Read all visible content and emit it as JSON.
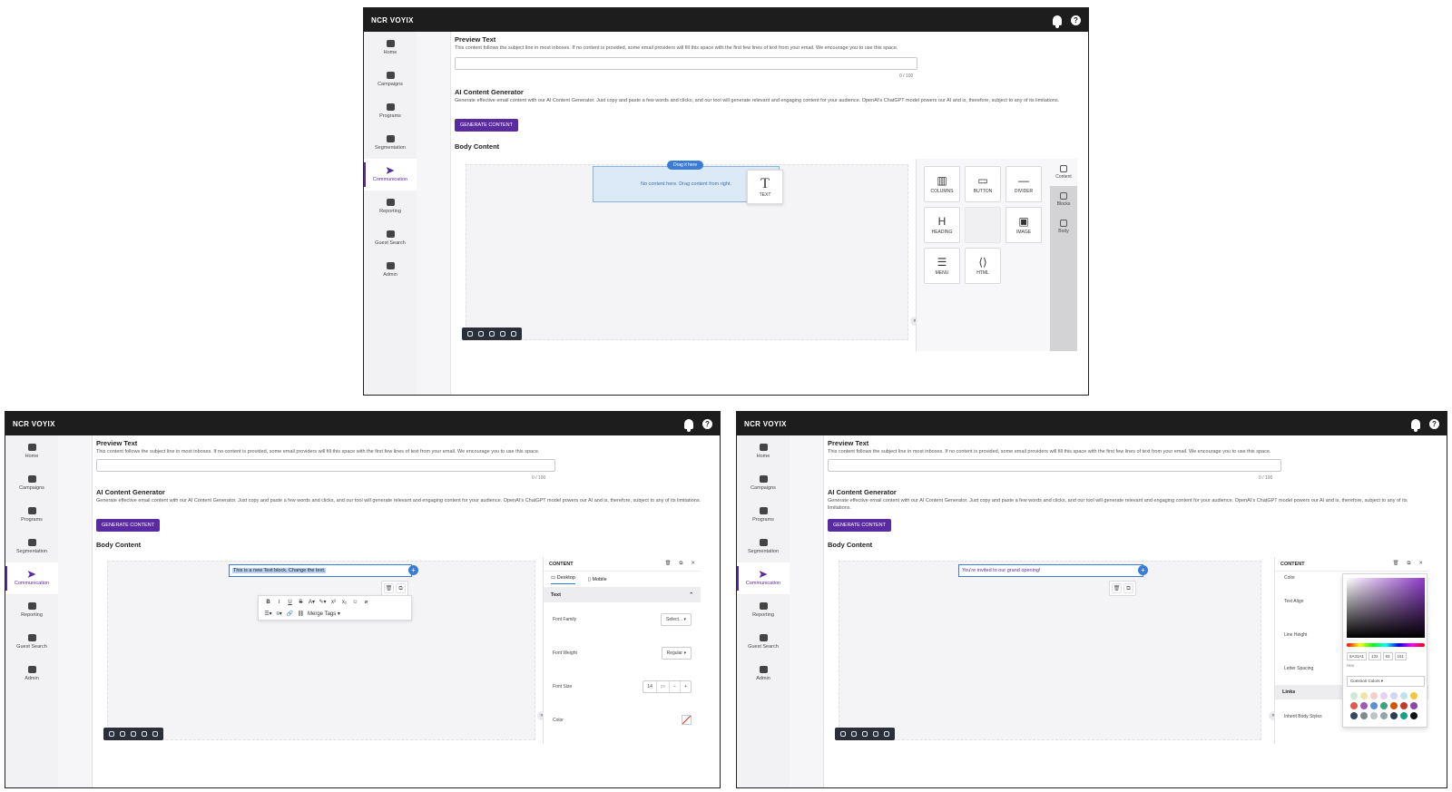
{
  "app": {
    "logo": "NCR VOYIX",
    "help": "?"
  },
  "nav": {
    "items": [
      {
        "label": "Home"
      },
      {
        "label": "Campaigns"
      },
      {
        "label": "Programs"
      },
      {
        "label": "Segmentation"
      },
      {
        "label": "Communication"
      },
      {
        "label": "Reporting"
      },
      {
        "label": "Guest Search"
      },
      {
        "label": "Admin"
      }
    ]
  },
  "form": {
    "preview_title": "Preview Text",
    "preview_desc": "This content follows the subject line in most inboxes. If no content is provided, some email providers will fill this space with the first few lines of text from your email. We encourage you to use this space.",
    "preview_counter": "0 / 100",
    "ai_title": "AI Content Generator",
    "ai_desc": "Generate effective email content with our AI Content Generator. Just copy and paste a few words and clicks, and our tool will generate relevant and engaging content for your audience. OpenAI's ChatGPT model powers our AI and is, therefore, subject to any of its limitations.",
    "generate_label": "GENERATE CONTENT",
    "body_title": "Body Content"
  },
  "builder": {
    "drag_pill": "Drag it here",
    "empty_text": "No content here. Drag content from right.",
    "drag_tile_label": "TEXT",
    "tools": [
      {
        "label": "COLUMNS",
        "icon": "columns-icon",
        "glyph": "▥"
      },
      {
        "label": "BUTTON",
        "icon": "button-icon",
        "glyph": "▭"
      },
      {
        "label": "DIVIDER",
        "icon": "divider-icon",
        "glyph": "—"
      },
      {
        "label": "HEADING",
        "icon": "heading-icon",
        "glyph": "H"
      },
      {
        "label": "",
        "icon": "",
        "glyph": ""
      },
      {
        "label": "IMAGE",
        "icon": "image-icon",
        "glyph": "▣"
      },
      {
        "label": "MENU",
        "icon": "menu-icon",
        "glyph": "☰"
      },
      {
        "label": "HTML",
        "icon": "html-icon",
        "glyph": "⟨⟩"
      }
    ],
    "rail_tabs": [
      {
        "label": "Content"
      },
      {
        "label": "Blocks"
      },
      {
        "label": "Body"
      }
    ]
  },
  "editor": {
    "text_block": "This is a new Text block. Change the text.",
    "merge_tags": "Merge Tags",
    "invite_text": "You're invited to our grand opening!",
    "props": {
      "title": "CONTENT",
      "tab_desktop": "Desktop",
      "tab_mobile": "Mobile",
      "section_text": "Text",
      "font_family_label": "Font Family",
      "font_family_value": "Select...",
      "font_weight_label": "Font Weight",
      "font_weight_value": "Regular",
      "font_size_label": "Font Size",
      "font_size_value": "14",
      "font_size_unit": "px",
      "color_label": "Color"
    },
    "props2": {
      "color_label": "Color",
      "text_align_label": "Text Align",
      "line_height_label": "Line Height",
      "letter_spacing_label": "Letter Spacing",
      "links_label": "Links",
      "inherit_label": "Inherit Body Styles"
    },
    "picker": {
      "hex": "8A31A1",
      "r": "132",
      "g": "83",
      "b": "161",
      "hex_label": "Hex",
      "common_colors": "Common Colors",
      "swatch_colors": [
        "#cfe9d6",
        "#f3e3a6",
        "#f5cfc9",
        "#e9d0ee",
        "#cfd6f3",
        "#bfe2ef",
        "#f4c542",
        "#e05a4e",
        "#9b59b6",
        "#5b8dd9",
        "#3aa37a",
        "#d35400",
        "#c0392b",
        "#8e44ad",
        "#34495e",
        "#7f8c8d",
        "#bdc3c7",
        "#95a5a6",
        "#2c3e50",
        "#16a085",
        "#111111"
      ],
      "accent": "#8e3cc8"
    }
  }
}
